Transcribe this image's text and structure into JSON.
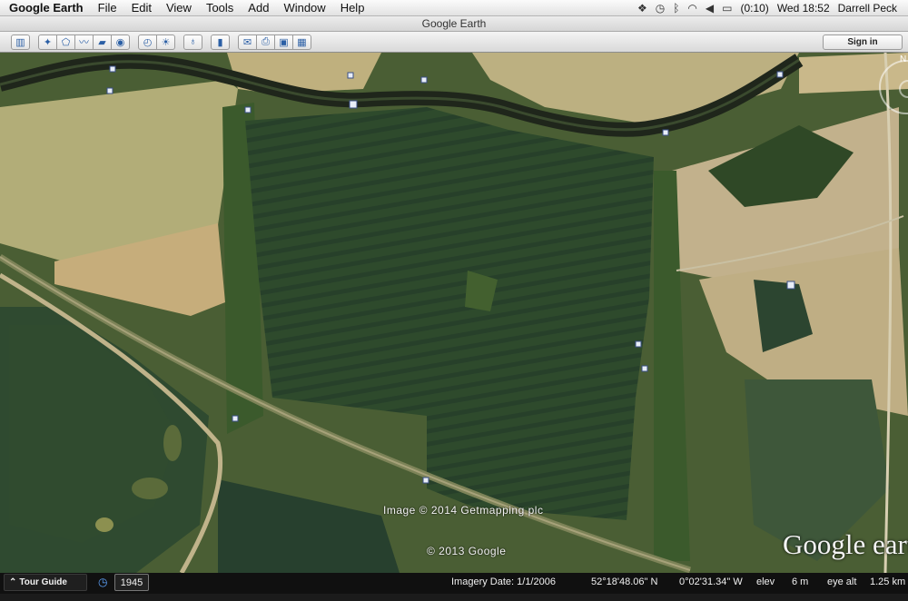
{
  "menubar": {
    "app_name": "Google Earth",
    "menus": [
      "File",
      "Edit",
      "View",
      "Tools",
      "Add",
      "Window",
      "Help"
    ],
    "battery": "(0:10)",
    "clock": "Wed 18:52",
    "user": "Darrell Peck"
  },
  "window": {
    "title": "Google Earth"
  },
  "toolbar": {
    "groups": [
      [
        "sidebar-toggle-icon"
      ],
      [
        "placemark-icon",
        "polygon-icon",
        "path-icon",
        "image-overlay-icon",
        "record-tour-icon"
      ],
      [
        "historical-imagery-icon",
        "sunlight-icon"
      ],
      [
        "planets-icon"
      ],
      [
        "ruler-icon"
      ],
      [
        "email-icon",
        "print-icon",
        "save-image-icon",
        "view-in-maps-icon"
      ]
    ],
    "sign_in_label": "Sign in"
  },
  "map": {
    "image_credit": "Image © 2014 Getmapping plc",
    "copyright": "© 2013 Google",
    "logo": "Google earth"
  },
  "statusbar": {
    "tour_guide_label": "Tour Guide",
    "year": "1945",
    "imagery_date": "Imagery Date: 1/1/2006",
    "latitude": "52°18'48.06\" N",
    "longitude": "0°02'31.34\" W",
    "elev_label": "elev",
    "elev_value": "6 m",
    "eye_alt_label": "eye alt",
    "eye_alt_value": "1.25 km"
  },
  "colors": {
    "water": "#2c4429",
    "field_light": "#b8b279",
    "field_tan": "#c4ad7b",
    "hedge": "#39532a",
    "river": "#2a3223"
  }
}
